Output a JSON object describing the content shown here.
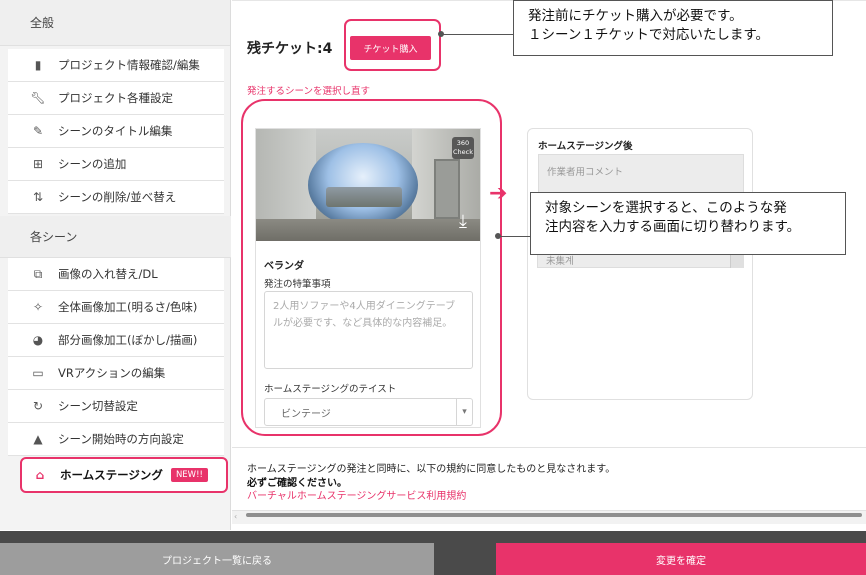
{
  "sidebar": {
    "section_general": "全般",
    "general_items": [
      {
        "label": "プロジェクト情報確認/編集",
        "icon": "file-icon"
      },
      {
        "label": "プロジェクト各種設定",
        "icon": "wrench-icon"
      },
      {
        "label": "シーンのタイトル編集",
        "icon": "pencil-icon"
      },
      {
        "label": "シーンの追加",
        "icon": "plus-box-icon"
      },
      {
        "label": "シーンの削除/並べ替え",
        "icon": "sort-icon"
      }
    ],
    "section_scene": "各シーン",
    "scene_items": [
      {
        "label": "画像の入れ替え/DL",
        "icon": "swap-image-icon"
      },
      {
        "label": "全体画像加工(明るさ/色味)",
        "icon": "magic-wand-icon"
      },
      {
        "label": "部分画像加工(ぼかし/描画)",
        "icon": "palette-icon"
      },
      {
        "label": "VRアクションの編集",
        "icon": "vr-goggles-icon"
      },
      {
        "label": "シーン切替設定",
        "icon": "refresh-icon"
      },
      {
        "label": "シーン開始時の方向設定",
        "icon": "direction-arrow-icon"
      }
    ],
    "active_item": {
      "label": "ホームステージング",
      "badge": "NEW!!",
      "icon": "home-icon"
    }
  },
  "main": {
    "tickets_label": "残チケット:4",
    "ticket_button": "チケット購入",
    "reselect_link": "発注するシーンを選択し直す",
    "scene": {
      "badge_360": "360",
      "badge_360_sub": "Check",
      "name": "ベランダ",
      "spec_label": "発注の特筆事項",
      "spec_placeholder": "2人用ソファーや4人用ダイニングテーブルが必要です、など具体的な内容補足。",
      "taste_label": "ホームステージングのテイスト",
      "taste_value": "ビンテージ"
    },
    "result": {
      "title": "ホームステージング後",
      "comment_placeholder": "作業者用コメント",
      "status": "未集계"
    },
    "terms": {
      "line1": "ホームステージングの発注と同時に、以下の規約に同意したものと見なされます。",
      "line2": "必ずご確認ください。",
      "link": "バーチャルホームステージングサービス利用規約"
    }
  },
  "footer": {
    "back": "プロジェクト一覧に戻る",
    "confirm": "変更を確定"
  },
  "callouts": {
    "top_line1": "発注前にチケット購入が必要です。",
    "top_line2": "１シーン１チケットで対応いたします。",
    "mid_line1": "対象シーンを選択すると、このような発",
    "mid_line2": "注内容を入力する画面に切り替わります。"
  },
  "colors": {
    "accent": "#e8336a",
    "footer": "#4a4a4a",
    "sidebar_bg": "#f3f3f3"
  }
}
